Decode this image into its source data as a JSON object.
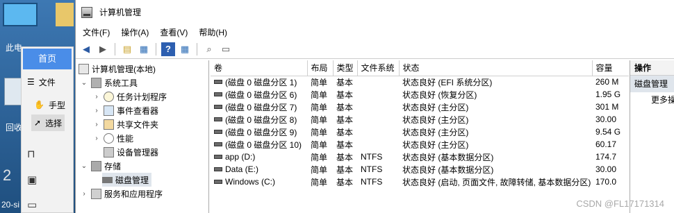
{
  "desktop": {
    "icon_label_1": "此电",
    "icon_label_2": "回收",
    "icon_label_3": "2",
    "icon_label_4": "20-si"
  },
  "photo_panel": {
    "home": "首页",
    "file": "文件",
    "hand": "手型",
    "select": "选择"
  },
  "window": {
    "title": "计算机管理",
    "menu": [
      "文件(F)",
      "操作(A)",
      "查看(V)",
      "帮助(H)"
    ]
  },
  "tree": {
    "root": "计算机管理(本地)",
    "system_tools": "系统工具",
    "task_scheduler": "任务计划程序",
    "event_viewer": "事件查看器",
    "shared_folders": "共享文件夹",
    "performance": "性能",
    "device_manager": "设备管理器",
    "storage": "存储",
    "disk_management": "磁盘管理",
    "services": "服务和应用程序"
  },
  "table": {
    "columns": [
      "卷",
      "布局",
      "类型",
      "文件系统",
      "状态",
      "容量"
    ],
    "rows": [
      [
        "(磁盘 0 磁盘分区 1)",
        "简单",
        "基本",
        "",
        "状态良好 (EFI 系统分区)",
        "260 M"
      ],
      [
        "(磁盘 0 磁盘分区 6)",
        "简单",
        "基本",
        "",
        "状态良好 (恢复分区)",
        "1.95 G"
      ],
      [
        "(磁盘 0 磁盘分区 7)",
        "简单",
        "基本",
        "",
        "状态良好 (主分区)",
        "301 M"
      ],
      [
        "(磁盘 0 磁盘分区 8)",
        "简单",
        "基本",
        "",
        "状态良好 (主分区)",
        "30.00"
      ],
      [
        "(磁盘 0 磁盘分区 9)",
        "简单",
        "基本",
        "",
        "状态良好 (主分区)",
        "9.54 G"
      ],
      [
        "(磁盘 0 磁盘分区 10)",
        "简单",
        "基本",
        "",
        "状态良好 (主分区)",
        "60.17"
      ],
      [
        "app (D:)",
        "简单",
        "基本",
        "NTFS",
        "状态良好 (基本数据分区)",
        "174.7"
      ],
      [
        "Data (E:)",
        "简单",
        "基本",
        "NTFS",
        "状态良好 (基本数据分区)",
        "30.00"
      ],
      [
        "Windows (C:)",
        "简单",
        "基本",
        "NTFS",
        "状态良好 (启动, 页面文件, 故障转储, 基本数据分区)",
        "170.0"
      ]
    ]
  },
  "actions": {
    "header": "操作",
    "section": "磁盘管理",
    "more": "更多操"
  },
  "watermark": "CSDN @FL17171314"
}
